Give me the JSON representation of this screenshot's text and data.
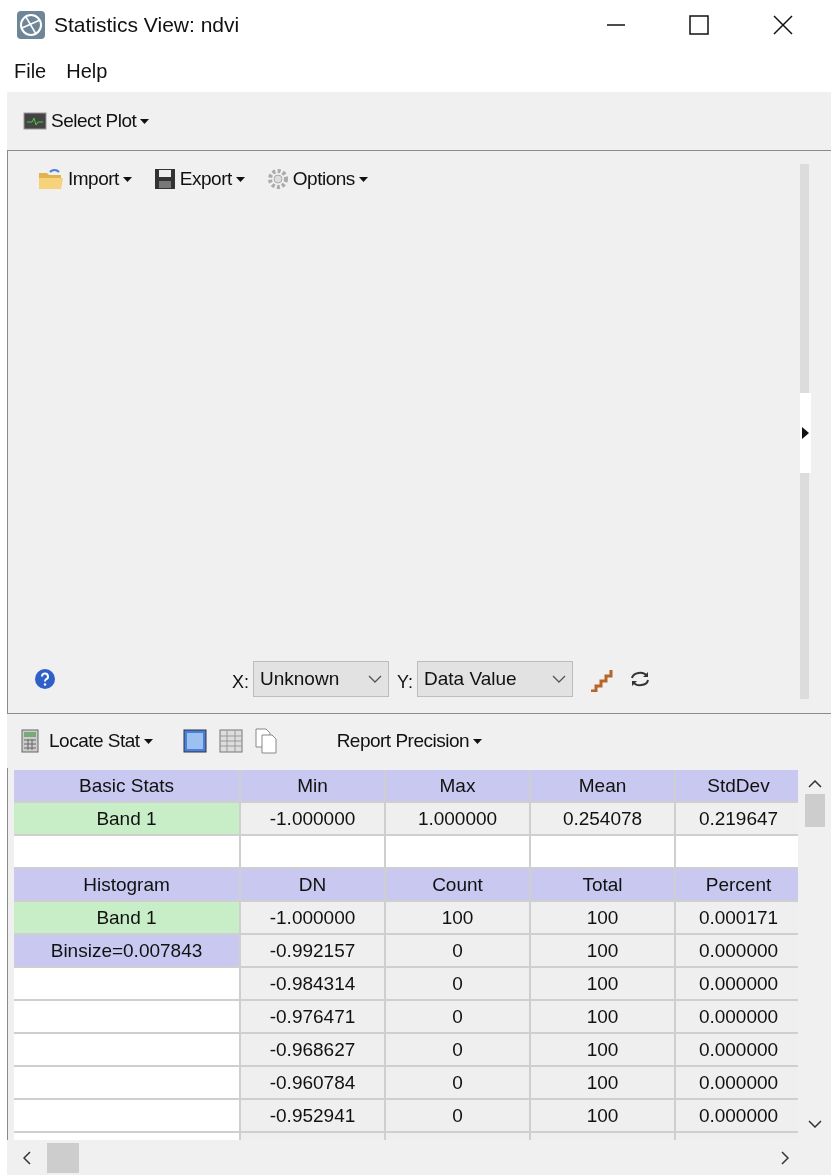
{
  "window": {
    "title": "Statistics View: ndvi"
  },
  "menu": [
    "File",
    "Help"
  ],
  "toolbar": {
    "select_plot": "Select Plot"
  },
  "plot_panel": {
    "buttons": [
      "Import",
      "Export",
      "Options"
    ],
    "x_axis": {
      "label": "X:",
      "value": "Unknown"
    },
    "y_axis": {
      "label": "Y:",
      "value": "Data Value"
    }
  },
  "stats_toolbar": {
    "locate": "Locate Stat",
    "precision": "Report Precision"
  },
  "table": {
    "rows": [
      {
        "kind": "header",
        "cells": [
          "Basic Stats",
          "Min",
          "Max",
          "Mean",
          "StdDev"
        ]
      },
      {
        "kind": "data",
        "label": "Band 1",
        "color": "#c8eec8",
        "cells": [
          "-1.000000",
          "1.000000",
          "0.254078",
          "0.219647"
        ]
      },
      {
        "kind": "blank"
      },
      {
        "kind": "header",
        "cells": [
          "Histogram",
          "DN",
          "Count",
          "Total",
          "Percent"
        ]
      },
      {
        "kind": "data",
        "label": "Band 1",
        "color": "#c8eec8",
        "cells": [
          "-1.000000",
          "100",
          "100",
          "0.000171"
        ]
      },
      {
        "kind": "data",
        "label": "Binsize=0.007843",
        "color": "#c8c8f0",
        "cells": [
          "-0.992157",
          "0",
          "100",
          "0.000000"
        ]
      },
      {
        "kind": "data",
        "cells": [
          "-0.984314",
          "0",
          "100",
          "0.000000"
        ]
      },
      {
        "kind": "data",
        "cells": [
          "-0.976471",
          "0",
          "100",
          "0.000000"
        ]
      },
      {
        "kind": "data",
        "cells": [
          "-0.968627",
          "0",
          "100",
          "0.000000"
        ]
      },
      {
        "kind": "data",
        "cells": [
          "-0.960784",
          "0",
          "100",
          "0.000000"
        ]
      },
      {
        "kind": "data",
        "cells": [
          "-0.952941",
          "0",
          "100",
          "0.000000"
        ]
      },
      {
        "kind": "partial"
      }
    ]
  }
}
